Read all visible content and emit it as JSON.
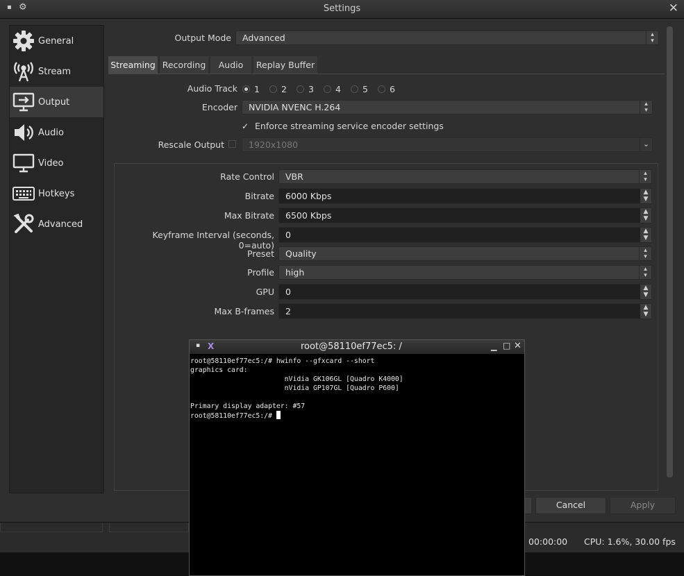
{
  "window": {
    "title": "Settings"
  },
  "sidebar": {
    "items": [
      {
        "label": "General",
        "icon": "gear-icon"
      },
      {
        "label": "Stream",
        "icon": "antenna-icon"
      },
      {
        "label": "Output",
        "icon": "monitor-arrow-icon",
        "selected": true
      },
      {
        "label": "Audio",
        "icon": "speaker-icon"
      },
      {
        "label": "Video",
        "icon": "monitor-icon"
      },
      {
        "label": "Hotkeys",
        "icon": "keyboard-icon"
      },
      {
        "label": "Advanced",
        "icon": "tools-icon"
      }
    ]
  },
  "output_mode": {
    "label": "Output Mode",
    "value": "Advanced"
  },
  "tabs": [
    {
      "label": "Streaming",
      "selected": true
    },
    {
      "label": "Recording"
    },
    {
      "label": "Audio"
    },
    {
      "label": "Replay Buffer"
    }
  ],
  "streaming": {
    "audio_track": {
      "label": "Audio Track",
      "options": [
        "1",
        "2",
        "3",
        "4",
        "5",
        "6"
      ],
      "selected": "1"
    },
    "encoder": {
      "label": "Encoder",
      "value": "NVIDIA NVENC H.264"
    },
    "enforce": {
      "label": "Enforce streaming service encoder settings",
      "checked": true,
      "mark": "✓"
    },
    "rescale": {
      "label": "Rescale Output",
      "value": "1920x1080",
      "checked": false
    },
    "rate_control": {
      "label": "Rate Control",
      "value": "VBR"
    },
    "bitrate": {
      "label": "Bitrate",
      "value": "6000 Kbps"
    },
    "max_bitrate": {
      "label": "Max Bitrate",
      "value": "6500 Kbps"
    },
    "keyframe": {
      "label": "Keyframe Interval (seconds, 0=auto)",
      "value": "0"
    },
    "preset": {
      "label": "Preset",
      "value": "Quality"
    },
    "profile": {
      "label": "Profile",
      "value": "high"
    },
    "gpu": {
      "label": "GPU",
      "value": "0"
    },
    "bframes": {
      "label": "Max B-frames",
      "value": "2"
    }
  },
  "buttons": {
    "cancel": "Cancel",
    "apply": "Apply"
  },
  "statusbar": {
    "time": "00:00:00",
    "cpu": "CPU: 1.6%, 30.00 fps"
  },
  "terminal": {
    "title": "root@58110ef77ec5: /",
    "lines": [
      "root@58110ef77ec5:/# hwinfo --gfxcard --short",
      "graphics card:",
      "                       nVidia GK106GL [Quadro K4000]",
      "                       nVidia GP107GL [Quadro P600]",
      "",
      "Primary display adapter: #57",
      "root@58110ef77ec5:/# "
    ]
  },
  "colors": {
    "background": "#2f2f2f",
    "sidebar": "#262626",
    "field": "#3d3d3d",
    "terminal": "#000000"
  }
}
